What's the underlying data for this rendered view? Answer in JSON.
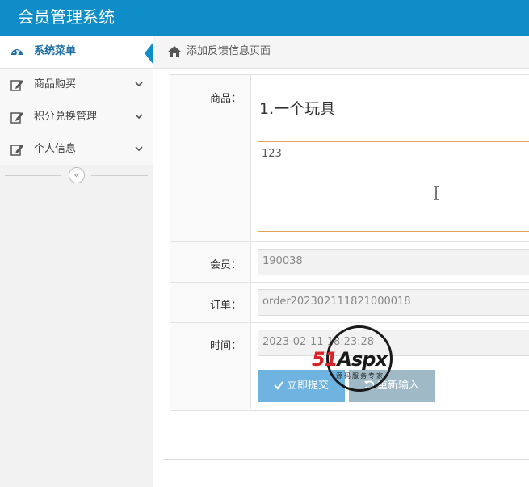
{
  "header": {
    "title": "会员管理系统"
  },
  "sidebar": {
    "items": [
      {
        "label": "系统菜单",
        "icon": "dashboard-icon",
        "active": true
      },
      {
        "label": "商品购买",
        "icon": "edit-icon"
      },
      {
        "label": "积分兑换管理",
        "icon": "edit-icon"
      },
      {
        "label": "个人信息",
        "icon": "edit-icon"
      }
    ],
    "collapse_symbol": "«"
  },
  "breadcrumb": {
    "icon": "home-icon",
    "text": "添加反馈信息页面"
  },
  "form": {
    "product": {
      "label": "商品：",
      "value": "1.一个玩具",
      "feedback": "123"
    },
    "member": {
      "label": "会员：",
      "value": "190038"
    },
    "order": {
      "label": "订单：",
      "value": "order202302111821000018"
    },
    "time": {
      "label": "时间：",
      "value": "2023-02-11 18:23:28"
    },
    "submit_label": "立即提交",
    "reset_label": "重新输入"
  },
  "watermark": {
    "mark_red": "51",
    "mark_dark": "Aspx",
    "mark_green": "x",
    "subtitle": "源码服务专家"
  },
  "colors": {
    "header": "#0f8dc9",
    "submit": "#6fb3e0",
    "reset": "#a0b9c6",
    "focus_border": "#e0a35a"
  }
}
